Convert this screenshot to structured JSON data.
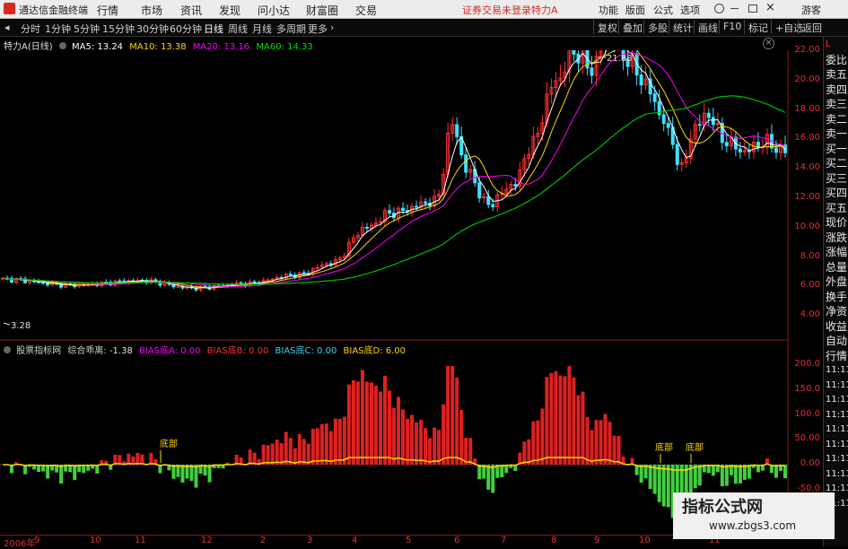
{
  "menubar": {
    "app_title": "通达信金融终端",
    "menus": [
      "行情",
      "市场",
      "资讯",
      "发现",
      "问小达",
      "财富圈",
      "交易"
    ],
    "login_warning": "证券交易未登录",
    "stock_name": "特力A",
    "right_menus": [
      "功能",
      "版面",
      "公式",
      "选项"
    ],
    "guest": "游客"
  },
  "periodbar": {
    "periods": [
      "分时",
      "1分钟",
      "5分钟",
      "15分钟",
      "30分钟",
      "60分钟",
      "日线",
      "周线",
      "月线",
      "多周期",
      "更多"
    ],
    "active": "日线",
    "tools": [
      "复权",
      "叠加",
      "多股",
      "统计",
      "画线",
      "F10",
      "标记",
      "+自选",
      "返回"
    ]
  },
  "main_chart": {
    "title": "特力A(日线)",
    "ma": [
      {
        "label": "MA5: 13.24",
        "color": "#ffffff"
      },
      {
        "label": "MA10: 13.38",
        "color": "#ffd700"
      },
      {
        "label": "MA20: 13.16",
        "color": "#ff00ff"
      },
      {
        "label": "MA60: 14.33",
        "color": "#00e000"
      }
    ],
    "y_ticks": [
      "22.00",
      "20.00",
      "18.00",
      "16.00",
      "14.00",
      "12.00",
      "10.00",
      "8.00",
      "6.00",
      "4.00"
    ],
    "high_label": "21.88",
    "low_label": "3.28"
  },
  "indicator": {
    "source": "股票指标网",
    "name": "综合乖离:",
    "values": [
      {
        "label": "-1.38",
        "color": "#e0e0e0"
      },
      {
        "label": "BIAS底A: 0.00",
        "color": "#ff00ff"
      },
      {
        "label": "BIAS底B: 0.00",
        "color": "#ff3030"
      },
      {
        "label": "BIAS底C: 0.00",
        "color": "#40d0ff"
      },
      {
        "label": "BIAS底D: 6.00",
        "color": "#ffd700"
      }
    ],
    "y_ticks": [
      "200.0",
      "150.0",
      "100.0",
      "50.00",
      "0.00",
      "-50.0"
    ],
    "bottom_labels": [
      "底部",
      "底部",
      "底部"
    ]
  },
  "x_axis": {
    "labels": [
      "2006年",
      "9",
      "10",
      "11",
      "12",
      "2",
      "3",
      "4",
      "5",
      "6",
      "7",
      "8",
      "9",
      "10",
      "11"
    ]
  },
  "sidepanel": {
    "items": [
      "L",
      "委比",
      "卖五",
      "卖四",
      "卖三",
      "卖二",
      "卖一",
      "买一",
      "买二",
      "买三",
      "买四",
      "买五",
      "现价",
      "涨跌",
      "涨幅",
      "总量",
      "外盘",
      "换手",
      "净资",
      "收益",
      "自动",
      "行情",
      "11:11",
      "11:11",
      "11:11",
      "11:11",
      "11:11",
      "11:11",
      "11:11",
      "11:11",
      "11:11",
      "11:11"
    ]
  },
  "watermark": {
    "title": "指标公式网",
    "url": "www.zbgs3.com"
  },
  "colors": {
    "axis_red": "#d33333",
    "candle_up": "#ff3030",
    "bar_up": "#e02020",
    "bar_down": "#40d040"
  }
}
